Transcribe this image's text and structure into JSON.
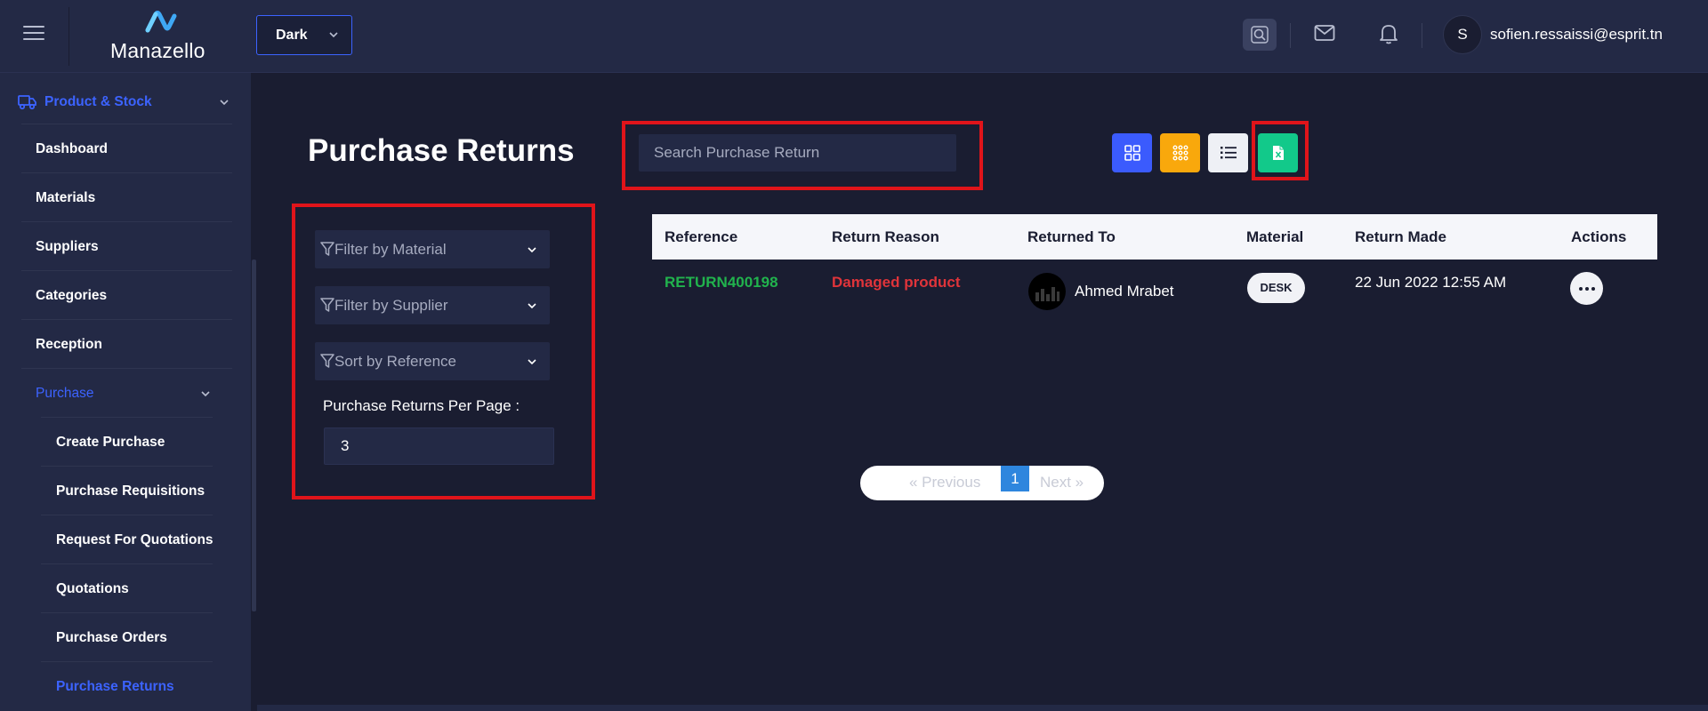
{
  "header": {
    "logo_text": "Manazello",
    "theme_select": "Dark",
    "user_initial": "S",
    "user_email": "sofien.ressaissi@esprit.tn"
  },
  "sidebar": {
    "group_label": "Product & Stock",
    "items": [
      {
        "label": "Dashboard"
      },
      {
        "label": "Materials"
      },
      {
        "label": "Suppliers"
      },
      {
        "label": "Categories"
      },
      {
        "label": "Reception"
      },
      {
        "label": "Purchase"
      }
    ],
    "sub_items": [
      {
        "label": "Create Purchase"
      },
      {
        "label": "Purchase Requisitions"
      },
      {
        "label": "Request For Quotations"
      },
      {
        "label": "Quotations"
      },
      {
        "label": "Purchase Orders"
      },
      {
        "label": "Purchase Returns"
      }
    ]
  },
  "main": {
    "title": "Purchase Returns",
    "search_placeholder": "Search Purchase Return",
    "filters": {
      "material": "Filter by Material",
      "supplier": "Filter by Supplier",
      "sort": "Sort by Reference",
      "per_page_label": "Purchase Returns Per Page :",
      "per_page_value": "3"
    },
    "table": {
      "headers": [
        "Reference",
        "Return Reason",
        "Returned To",
        "Material",
        "Return Made",
        "Actions"
      ],
      "rows": [
        {
          "reference": "RETURN400198",
          "reason": "Damaged product",
          "returned_to": "Ahmed Mrabet",
          "material": "DESK",
          "return_made": "22 Jun 2022 12:55 AM"
        }
      ]
    },
    "pagination": {
      "prev": "«   Previous",
      "current": "1",
      "next": "Next   »"
    }
  },
  "colors": {
    "accent": "#3c63ff",
    "highlight_box": "#e0141a",
    "reference": "#21b34d",
    "reason": "#e0343a",
    "grid_btn": "#3b5bfd",
    "apps_btn": "#f9a80c",
    "excel_btn": "#12c98a"
  }
}
